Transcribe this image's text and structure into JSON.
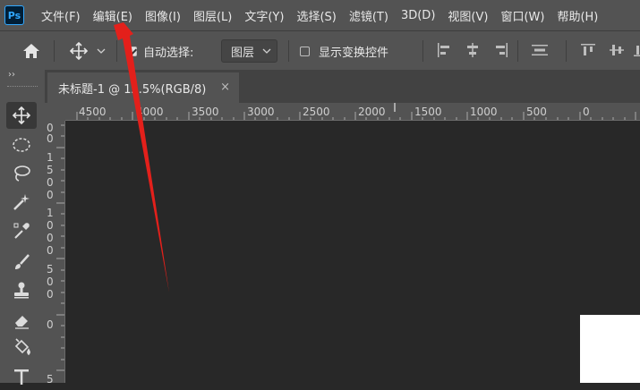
{
  "app": {
    "logo": "Ps"
  },
  "menu": [
    "文件(F)",
    "编辑(E)",
    "图像(I)",
    "图层(L)",
    "文字(Y)",
    "选择(S)",
    "滤镜(T)",
    "3D(D)",
    "视图(V)",
    "窗口(W)",
    "帮助(H)"
  ],
  "options": {
    "auto_select_label": "自动选择:",
    "auto_select_checked": true,
    "target_value": "图层",
    "show_transform_label": "显示变换控件",
    "show_transform_checked": false
  },
  "toolbar": {
    "collapse_glyph": "››"
  },
  "document_tab": {
    "title": "未标题-1 @ 12.5%(RGB/8)",
    "close": "×"
  },
  "ruler_h": [
    "4500",
    "4000",
    "3500",
    "3000",
    "2500",
    "2000",
    "1500",
    "1000",
    "500",
    "0"
  ],
  "ruler_v": [
    "0",
    "0",
    "1",
    "5",
    "0",
    "0",
    "1",
    "0",
    "0",
    "0",
    "5",
    "0",
    "0",
    "0",
    "5"
  ],
  "colors": {
    "annotation_arrow": "#e3201b",
    "panel": "#535353",
    "canvas_bg": "#282828",
    "accent": "#31a8ff"
  },
  "icons": [
    "home-icon",
    "move-icon",
    "marquee-icon",
    "lasso-icon",
    "magic-wand-icon",
    "eyedropper-icon",
    "brush-icon",
    "stamp-icon",
    "eraser-icon",
    "paint-bucket-icon",
    "type-icon"
  ]
}
